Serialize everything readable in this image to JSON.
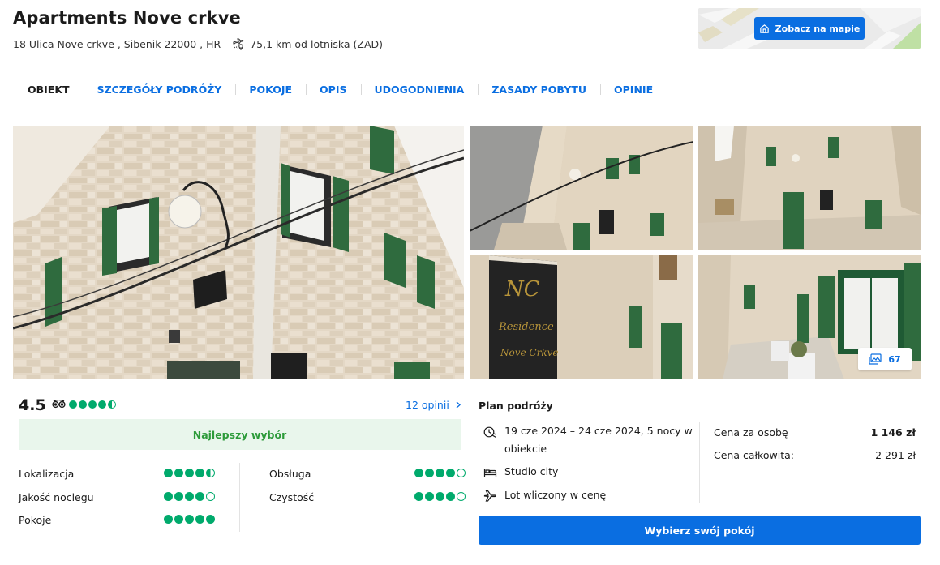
{
  "hotel": {
    "name": "Apartments Nove crkve",
    "address": "18 Ulica Nove crkve , Sibenik 22000 , HR",
    "airport_distance": "75,1 km od lotniska (ZAD)"
  },
  "map": {
    "button_label": "Zobacz na mapie"
  },
  "tabs": [
    {
      "label": "OBIEKT",
      "active": true
    },
    {
      "label": "SZCZEGÓŁY PODRÓŻY"
    },
    {
      "label": "POKOJE"
    },
    {
      "label": "OPIS"
    },
    {
      "label": "UDOGODNIENIA"
    },
    {
      "label": "ZASADY POBYTU"
    },
    {
      "label": "OPINIE"
    }
  ],
  "gallery": {
    "photo_count": "67"
  },
  "rating": {
    "score": "4.5",
    "tripadvisor_bubbles": 4.5,
    "opinions_link": "12 opinii",
    "badge": "Najlepszy wybór",
    "categories": [
      {
        "label": "Lokalizacja",
        "value": 4.5
      },
      {
        "label": "Jakość noclegu",
        "value": 4
      },
      {
        "label": "Pokoje",
        "value": 5
      },
      {
        "label": "Obsługa",
        "value": 4
      },
      {
        "label": "Czystość",
        "value": 4
      }
    ]
  },
  "plan": {
    "title": "Plan podróży",
    "dates_line1": "19 cze 2024 – 24 cze 2024, 5 nocy w",
    "dates_line2": "obiekcie",
    "room": "Studio city",
    "flight": "Lot wliczony w cenę",
    "price_per_person_label": "Cena za osobę",
    "price_per_person": "1 146 zł",
    "price_total_label": "Cena całkowita:",
    "price_total": "2 291 zł",
    "cta": "Wybierz swój pokój"
  },
  "colors": {
    "accent": "#0a6ee1",
    "rating_green": "#00aa6c",
    "badge_bg": "#e9f6ec",
    "badge_text": "#2d9b3a"
  },
  "icons": [
    "airport-distance-icon",
    "map-pin-icon",
    "tripadvisor-icon",
    "chevron-right-icon",
    "photos-icon",
    "calendar-icon",
    "bed-icon",
    "plane-icon"
  ]
}
